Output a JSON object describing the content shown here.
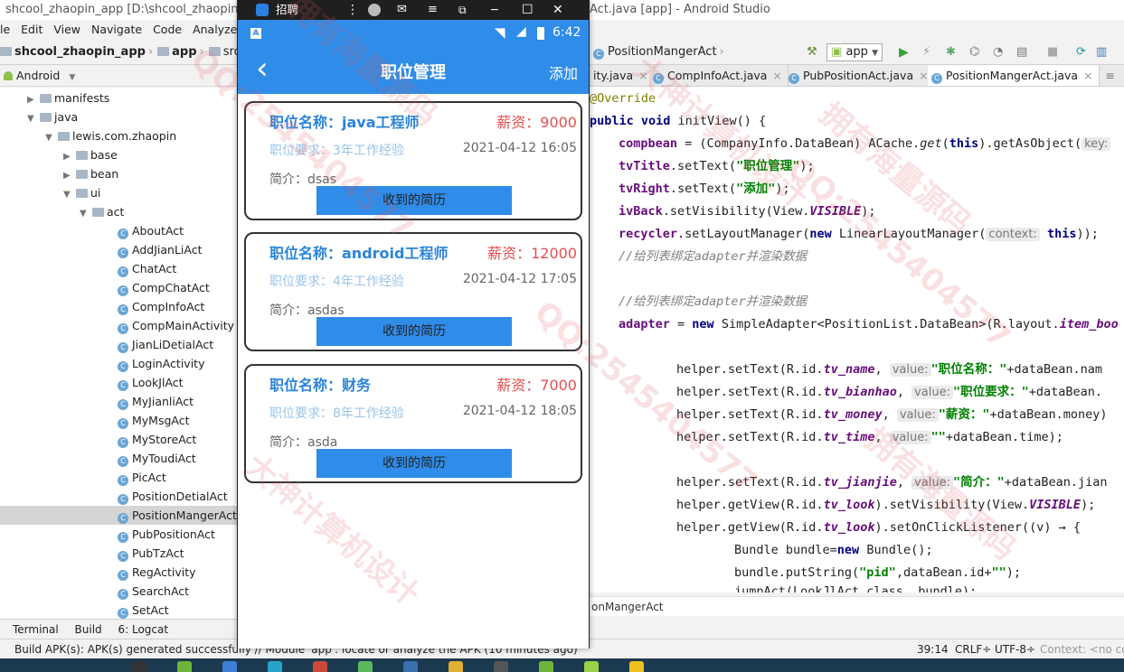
{
  "studio": {
    "title": "shcool_zhaopin_app [D:\\shcool_zhaopin_app",
    "title_right": "Act.java [app] - Android Studio",
    "menu": [
      "le",
      "Edit",
      "View",
      "Navigate",
      "Code",
      "Analyze"
    ],
    "breadcrumb": [
      "shcool_zhaopin_app",
      "app",
      "src"
    ],
    "project_view": "Android",
    "nav_file": "PositionMangerAct",
    "run_config": "app",
    "tabs": [
      "ity.java",
      "CompInfoAct.java",
      "PubPositionAct.java",
      "PositionMangerAct.java"
    ],
    "tree": {
      "manifests": "manifests",
      "java": "java",
      "package": "lewis.com.zhaopin",
      "base": "base",
      "bean": "bean",
      "ui": "ui",
      "act": "act",
      "classes": [
        "AboutAct",
        "AddJianLiAct",
        "ChatAct",
        "CompChatAct",
        "CompInfoAct",
        "CompMainActivity",
        "JianLiDetialAct",
        "LoginActivity",
        "LookJlAct",
        "MyJianliAct",
        "MyMsgAct",
        "MyStoreAct",
        "MyToudiAct",
        "PicAct",
        "PositionDetialAct",
        "PositionMangerAct",
        "PubPositionAct",
        "PubTzAct",
        "RegActivity",
        "SearchAct",
        "SetAct"
      ],
      "selected": "PositionMangerAct"
    },
    "bottom_tabs": [
      "Terminal",
      "Build",
      "6: Logcat"
    ],
    "status_message": "Build APK(s): APK(s) generated successfully // Module 'app': locate or analyze the APK (10 minutes ago)",
    "status_right": [
      "39:14",
      "CRLF÷",
      "UTF-8÷",
      "Context: <no co"
    ],
    "editor_breadcrumb": "onMangerAct"
  },
  "code": {
    "l1": "@Override",
    "l2a": "public void ",
    "l2b": "initView() {",
    "l3a": "compbean",
    "l3b": " = (CompanyInfo.DataBean) ACache.",
    "l3c": "get",
    "l3d": "(",
    "l3e": "this",
    "l3f": ").getAsObject(",
    "l3hint": "key:",
    "l4a": "tvTitle",
    "l4b": ".setText(",
    "l4c": "\"职位管理\"",
    "l4d": ");",
    "l5a": "tvRight",
    "l5b": ".setText(",
    "l5c": "\"添加\"",
    "l5d": ");",
    "l6a": "ivBack",
    "l6b": ".setVisibility(View.",
    "l6c": "VISIBLE",
    "l6d": ");",
    "l7a": "recycler",
    "l7b": ".setLayoutManager(",
    "l7c": "new ",
    "l7d": "LinearLayoutManager(",
    "l7hint": "context:",
    "l7e": " this",
    "l7f": "));",
    "l8": "//给列表绑定adapter并渲染数据",
    "l9": "//给列表绑定adapter并渲染数据",
    "l10a": "adapter",
    "l10b": " = ",
    "l10c": "new ",
    "l10d": "SimpleAdapter<PositionList.DataBean>(R.layout.",
    "l10e": "item_boo",
    "l11a": "helper.setText(R.id.",
    "l11b": "tv_name",
    "l11hint": "value:",
    "l11c": "\"职位名称：\"",
    "l11d": "+dataBean.nam",
    "l12a": "helper.setText(R.id.",
    "l12b": "tv_bianhao",
    "l12hint": "value:",
    "l12c": "\"职位要求：\"",
    "l12d": "+dataBean.",
    "l13a": "helper.setText(R.id.",
    "l13b": "tv_money",
    "l13hint": "value:",
    "l13c": "\"薪资：\"",
    "l13d": "+dataBean.money)",
    "l14a": "helper.setText(R.id.",
    "l14b": "tv_time",
    "l14hint": "value:",
    "l14c": "\"\"",
    "l14d": "+dataBean.time);",
    "l15a": "helper.setText(R.id.",
    "l15b": "tv_jianjie",
    "l15hint": "value:",
    "l15c": "\"简介：\"",
    "l15d": "+dataBean.jian",
    "l16a": "helper.getView(R.id.",
    "l16b": "tv_look",
    "l16c": ").setVisibility(View.",
    "l16d": "VISIBLE",
    "l16e": ");",
    "l17a": "helper.getView(R.id.",
    "l17b": "tv_look",
    "l17c": ").setOnClickListener((v) → {",
    "l18a": "Bundle bundle=",
    "l18b": "new ",
    "l18c": "Bundle();",
    "l19a": "bundle.putString(",
    "l19b": "\"pid\"",
    "l19c": ",dataBean.id+",
    "l19d": "\"\"",
    "l19e": ");",
    "l20": "jumpAct(LookJlAct.class, bundle);"
  },
  "emulator": {
    "window_title": "招聘",
    "status_time": "6:42",
    "toolbar_title": "职位管理",
    "toolbar_right": "添加",
    "items": [
      {
        "name": "职位名称：java工程师",
        "money": "薪资：9000",
        "req": "职位要求：3年工作经验",
        "time": "2021-04-12 16:05",
        "intro": "简介：dsas",
        "button": "收到的简历"
      },
      {
        "name": "职位名称：android工程师",
        "money": "薪资：12000",
        "req": "职位要求：4年工作经验",
        "time": "2021-04-12 17:05",
        "intro": "简介：asdas",
        "button": "收到的简历"
      },
      {
        "name": "职位名称：财务",
        "money": "薪资：7000",
        "req": "职位要求：8年工作经验",
        "time": "2021-04-12 18:05",
        "intro": "简介：asda",
        "button": "收到的简历"
      }
    ]
  },
  "watermarks": [
    "QQ:2545404577",
    "拥有海量源码",
    "大神计算机设计",
    "QQ:2545404577",
    "拥有海量源码",
    "大神计算机设计",
    "QQ:2545404577",
    "拥有海量源码"
  ],
  "colors": {
    "accent": "#2f8ce8",
    "money": "#e25050",
    "name": "#2a84d8"
  }
}
